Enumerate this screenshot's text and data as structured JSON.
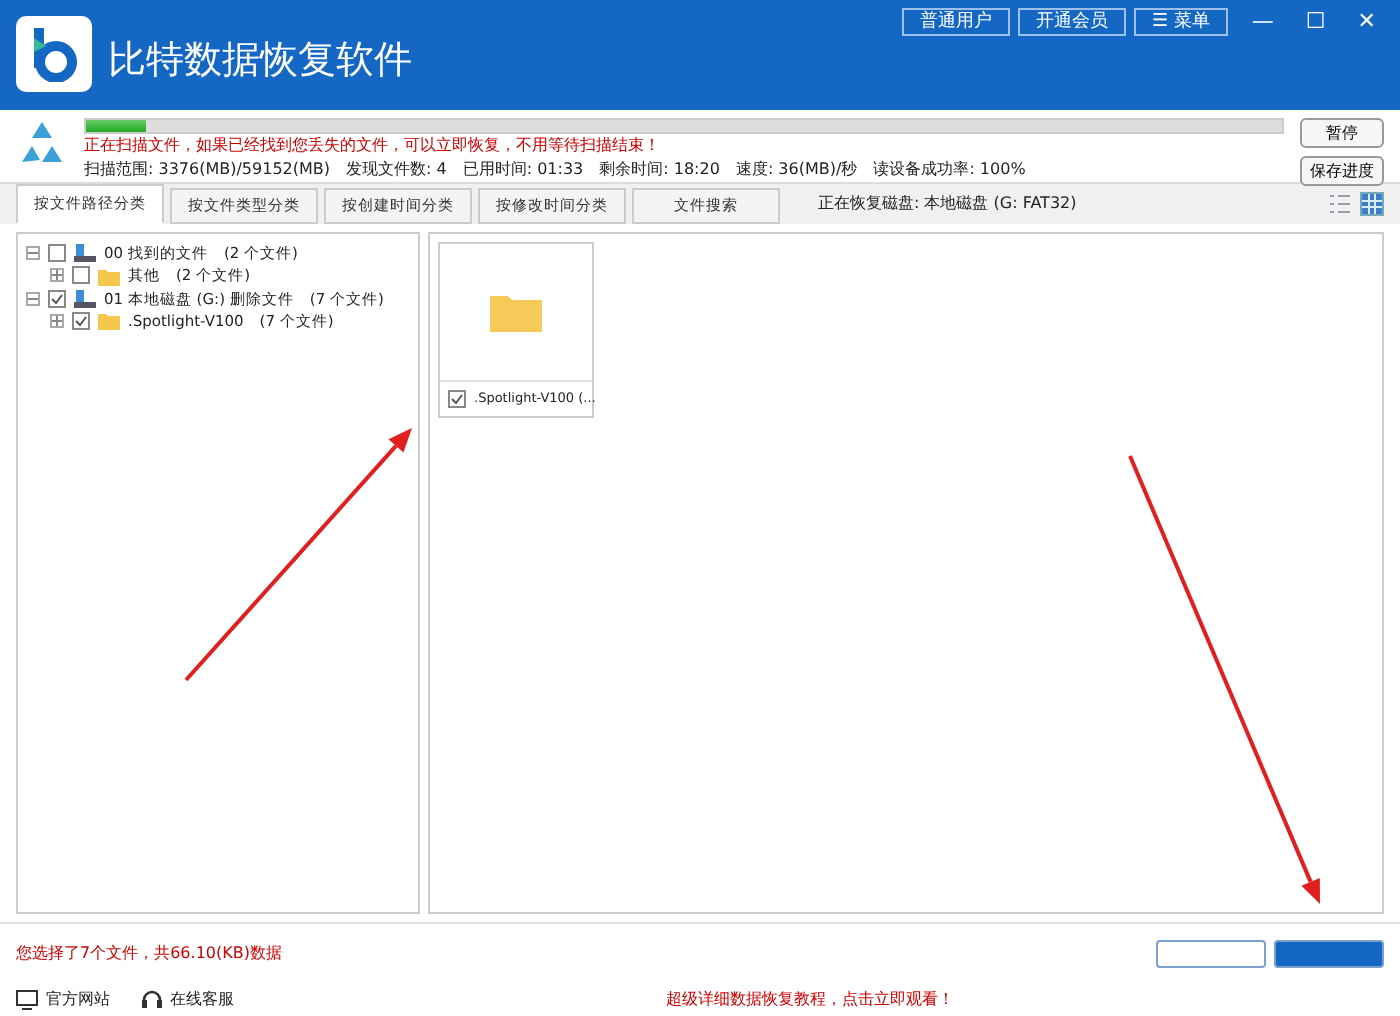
{
  "window": {
    "title": "比特数据恢复软件",
    "buttons": [
      "普通用户",
      "开通会员"
    ],
    "menu": {
      "icon": "☰",
      "label": "菜单"
    },
    "controls": [
      "—",
      "☐",
      "✕"
    ]
  },
  "scan": {
    "level": 0.05,
    "message": "正在扫描文件，如果已经找到您丢失的文件，可以立即恢复，不用等待扫描结束！",
    "stats": [
      "扫描范围: 3376(MB)/59152(MB)",
      "发现文件数: 4",
      "已用时间: 01:33",
      "剩余时间: 18:20",
      "速度: 36(MB)/秒",
      "读设备成功率: 100%"
    ],
    "buttons": [
      "暂停",
      "保存进度"
    ]
  },
  "tabs": [
    {
      "label": "按文件路径分类",
      "selected": true
    },
    {
      "label": "按文件类型分类",
      "selected": false
    },
    {
      "label": "按创建时间分类",
      "selected": false
    },
    {
      "label": "按修改时间分类",
      "selected": false
    },
    {
      "label": "文件搜索",
      "selected": false
    }
  ],
  "current_disk": "正在恢复磁盘: 本地磁盘 (G: FAT32)",
  "view_modes": [
    {
      "kind": "list",
      "selected": false
    },
    {
      "kind": "grid",
      "selected": true
    }
  ],
  "tree": [
    {
      "kind": "drive",
      "label": "00 找到的文件",
      "count": "(2 个文件)",
      "checked": false,
      "children": [
        {
          "kind": "folder",
          "label": "其他",
          "count": "(2 个文件)",
          "checked": false
        }
      ]
    },
    {
      "kind": "drive",
      "label": "01 本地磁盘 (G:) 删除文件",
      "count": "(7 个文件)",
      "checked": true,
      "children": [
        {
          "kind": "folder",
          "label": ".Spotlight-V100",
          "count": "(7 个文件)",
          "checked": true
        }
      ]
    }
  ],
  "files": [
    {
      "name": ".Spotlight-V100  (...",
      "checked": true
    }
  ],
  "selection_summary": "您选择了7个文件，共66.10(KB)数据",
  "footer_links": [
    {
      "kind": "website",
      "label": "官方网站"
    },
    {
      "kind": "support",
      "label": "在线客服"
    }
  ],
  "tutorial_link": "超级详细数据恢复教程，点击立即观看！",
  "annotations": [
    {
      "kind": "arrow"
    },
    {
      "kind": "arrow"
    }
  ]
}
